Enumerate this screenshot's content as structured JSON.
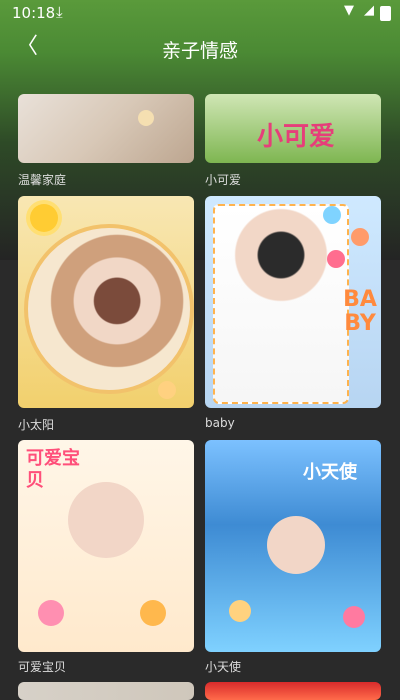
{
  "status": {
    "time": "10:18",
    "download_glyph": "⤓",
    "wifi_glyph": "▼",
    "signal_glyph": "◢"
  },
  "header": {
    "title": "亲子情感",
    "back_glyph": "〈"
  },
  "cards": [
    {
      "label": "温馨家庭"
    },
    {
      "label": "小可爱",
      "text": "小可爱"
    },
    {
      "label": "小太阳"
    },
    {
      "label": "baby",
      "text": "BABY"
    },
    {
      "label": "可爱宝贝",
      "text": "可爱宝贝"
    },
    {
      "label": "小天使",
      "text": "小天使"
    }
  ]
}
